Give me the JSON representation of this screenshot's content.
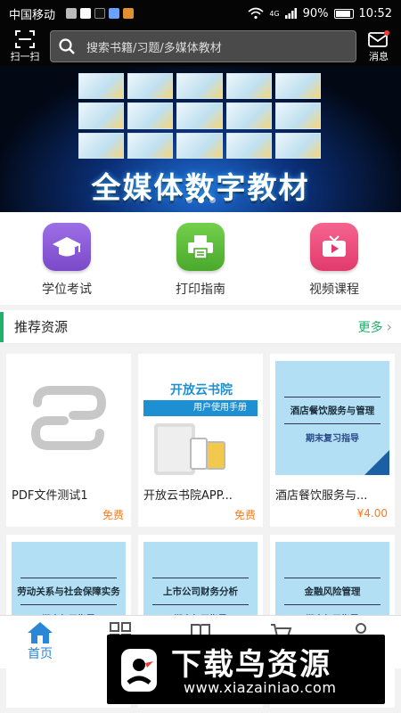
{
  "status_bar": {
    "carrier": "中国移动",
    "battery": "90%",
    "time": "10:52",
    "signal_label": "4G"
  },
  "header": {
    "scan_label": "扫一扫",
    "search_placeholder": "搜索书籍/习题/多媒体教材",
    "message_label": "消息"
  },
  "banner": {
    "title": "全媒体数字教材",
    "slide_count": 3,
    "active_slide": 1
  },
  "quick_menu": [
    {
      "label": "学位考试",
      "icon": "graduation-cap-icon",
      "color": "#8a5bd6"
    },
    {
      "label": "打印指南",
      "icon": "printer-icon",
      "color": "#5cbd3a"
    },
    {
      "label": "视频课程",
      "icon": "tv-icon",
      "color": "#ec4a7e"
    }
  ],
  "recommend": {
    "title": "推荐资源",
    "more_label": "更多"
  },
  "cards": [
    {
      "name": "PDF文件测试1",
      "price": "免费",
      "cover": "placeholder"
    },
    {
      "name": "开放云书院APP...",
      "price": "免费",
      "cover_title": "开放云书院",
      "cover_sub": "用户使用手册"
    },
    {
      "name": "酒店餐饮服务与...",
      "price": "¥4.00",
      "cover_title": "酒店餐饮服务与管理",
      "cover_sub": "期末复习指导"
    },
    {
      "cover_title": "劳动关系与社会保障实务",
      "cover_sub": "期末复习指导"
    },
    {
      "cover_title": "上市公司财务分析",
      "cover_sub": "期末复习指导"
    },
    {
      "cover_title": "金融风险管理",
      "cover_sub": "期末复习指导"
    }
  ],
  "bottom_nav": [
    {
      "label": "首页",
      "icon": "home-icon",
      "active": true
    },
    {
      "label": "",
      "icon": "grid-icon"
    },
    {
      "label": "",
      "icon": "book-icon"
    },
    {
      "label": "",
      "icon": "cart-icon"
    },
    {
      "label": "",
      "icon": "user-icon"
    }
  ],
  "watermark": {
    "text": "下载鸟资源",
    "url": "www.xiazainiao.com"
  },
  "colors": {
    "accent_green": "#20b26b",
    "price_orange": "#ff7a1a",
    "nav_active": "#2a86d6"
  }
}
